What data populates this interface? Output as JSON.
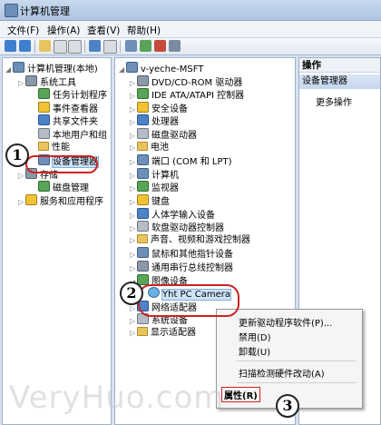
{
  "window": {
    "title": "计算机管理"
  },
  "menu": [
    "文件(F)",
    "操作(A)",
    "查看(V)",
    "帮助(H)"
  ],
  "left_tree": [
    {
      "label": "计算机管理(本地)",
      "indent": 0,
      "icon": "computer-icon"
    },
    {
      "label": "系统工具",
      "indent": 1,
      "icon": "tools-icon"
    },
    {
      "label": "任务计划程序",
      "indent": 2,
      "icon": "clock-icon"
    },
    {
      "label": "事件查看器",
      "indent": 2,
      "icon": "event-viewer-icon"
    },
    {
      "label": "共享文件夹",
      "indent": 2,
      "icon": "shared-folder-icon"
    },
    {
      "label": "本地用户和组",
      "indent": 2,
      "icon": "users-icon"
    },
    {
      "label": "性能",
      "indent": 2,
      "icon": "performance-icon"
    },
    {
      "label": "设备管理器",
      "indent": 2,
      "icon": "device-manager-icon",
      "selected": true
    },
    {
      "label": "存储",
      "indent": 1,
      "icon": "storage-icon"
    },
    {
      "label": "磁盘管理",
      "indent": 2,
      "icon": "disk-management-icon"
    },
    {
      "label": "服务和应用程序",
      "indent": 1,
      "icon": "services-icon"
    }
  ],
  "device_tree": [
    {
      "label": "v-yeche-MSFT",
      "indent": 0,
      "icon": "computer-icon"
    },
    {
      "label": "DVD/CD-ROM 驱动器",
      "indent": 1,
      "icon": "dvd-icon"
    },
    {
      "label": "IDE ATA/ATAPI 控制器",
      "indent": 1,
      "icon": "ide-icon"
    },
    {
      "label": "安全设备",
      "indent": 1,
      "icon": "security-icon"
    },
    {
      "label": "处理器",
      "indent": 1,
      "icon": "processor-icon"
    },
    {
      "label": "磁盘驱动器",
      "indent": 1,
      "icon": "disk-icon"
    },
    {
      "label": "电池",
      "indent": 1,
      "icon": "battery-icon"
    },
    {
      "label": "端口 (COM 和 LPT)",
      "indent": 1,
      "icon": "port-icon"
    },
    {
      "label": "计算机",
      "indent": 1,
      "icon": "computer-icon"
    },
    {
      "label": "监视器",
      "indent": 1,
      "icon": "monitor-icon"
    },
    {
      "label": "键盘",
      "indent": 1,
      "icon": "keyboard-icon"
    },
    {
      "label": "人体学输入设备",
      "indent": 1,
      "icon": "hid-icon"
    },
    {
      "label": "软盘驱动器控制器",
      "indent": 1,
      "icon": "floppy-icon"
    },
    {
      "label": "声音、视频和游戏控制器",
      "indent": 1,
      "icon": "sound-icon"
    },
    {
      "label": "鼠标和其他指针设备",
      "indent": 1,
      "icon": "mouse-icon"
    },
    {
      "label": "通用串行总线控制器",
      "indent": 1,
      "icon": "usb-icon"
    },
    {
      "label": "图像设备",
      "indent": 1,
      "icon": "imaging-icon",
      "expanded": true
    },
    {
      "label": "Yht PC Camera",
      "indent": 2,
      "icon": "camera-icon",
      "selected": true
    },
    {
      "label": "网络适配器",
      "indent": 1,
      "icon": "network-icon"
    },
    {
      "label": "系统设备",
      "indent": 1,
      "icon": "system-icon"
    },
    {
      "label": "显示适配器",
      "indent": 1,
      "icon": "display-icon"
    }
  ],
  "actions_pane": {
    "header": "操作",
    "section": "设备管理器",
    "more": "更多操作"
  },
  "context_menu": [
    "更新驱动程序软件(P)...",
    "禁用(D)",
    "卸载(U)",
    "扫描检测硬件改动(A)",
    "属性(R)"
  ],
  "callouts": [
    "1",
    "2",
    "3"
  ],
  "watermark": "VeryHuo.com"
}
